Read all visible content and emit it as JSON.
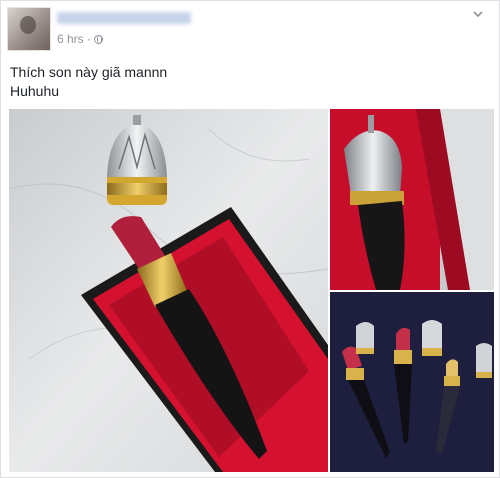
{
  "post": {
    "timestamp": "6 hrs",
    "separator": "·",
    "message_lines": [
      "Thích son này giã mannn",
      "Huhuhu"
    ]
  },
  "icons": {
    "privacy": "globe-icon",
    "options": "chevron-down-icon"
  },
  "colors": {
    "meta_text": "#90949c",
    "body_text": "#1d2129",
    "lipstick_red": "#b01f3b",
    "box_red": "#d4112f"
  }
}
